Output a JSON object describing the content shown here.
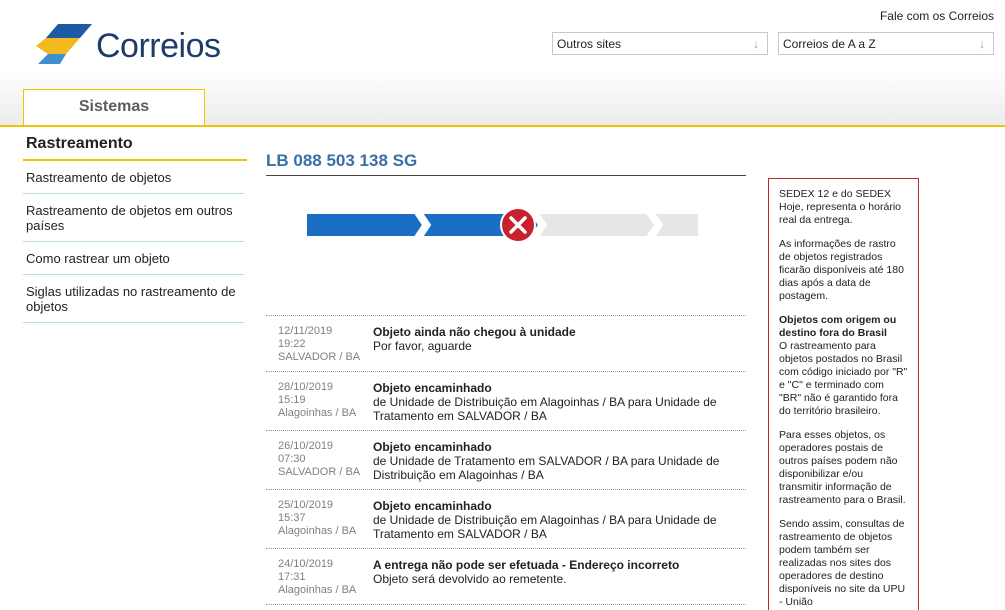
{
  "header": {
    "logo_text": "Correios",
    "contact_link": "Fale com os Correios",
    "select_other_sites": "Outros sites",
    "select_a_to_z": "Correios de A a Z",
    "tab_label": "Sistemas"
  },
  "sidebar": {
    "title": "Rastreamento",
    "items": [
      {
        "label": "Rastreamento de objetos"
      },
      {
        "label": "Rastreamento de objetos em outros países"
      },
      {
        "label": "Como rastrear um objeto"
      },
      {
        "label": "Siglas utilizadas no rastreamento de objetos"
      }
    ]
  },
  "tracking": {
    "code": "LB 088 503 138 SG",
    "progress": {
      "completed_steps": 2,
      "total_steps": 4,
      "status": "error",
      "status_icon": "x-circle-icon",
      "active_color": "#1a6fc4",
      "inactive_color": "#e6e6e6",
      "error_color": "#c8202e"
    },
    "events": [
      {
        "date": "12/11/2019",
        "time": "19:22",
        "place": "SALVADOR / BA",
        "title": "Objeto ainda não chegou à unidade",
        "detail": "Por favor, aguarde"
      },
      {
        "date": "28/10/2019",
        "time": "15:19",
        "place": "Alagoinhas / BA",
        "title": "Objeto encaminhado",
        "detail": "de Unidade de Distribuição em Alagoinhas / BA para Unidade de Tratamento em SALVADOR / BA"
      },
      {
        "date": "26/10/2019",
        "time": "07:30",
        "place": "SALVADOR / BA",
        "title": "Objeto encaminhado",
        "detail": "de Unidade de Tratamento em SALVADOR / BA para Unidade de Distribuição em Alagoinhas / BA"
      },
      {
        "date": "25/10/2019",
        "time": "15:37",
        "place": "Alagoinhas / BA",
        "title": "Objeto encaminhado",
        "detail": "de Unidade de Distribuição em Alagoinhas / BA para Unidade de Tratamento em SALVADOR / BA"
      },
      {
        "date": "24/10/2019",
        "time": "17:31",
        "place": "Alagoinhas / BA",
        "title": "A entrega não pode ser efetuada - Endereço incorreto",
        "detail": "Objeto será devolvido ao remetente."
      }
    ]
  },
  "info_box": {
    "p1": "SEDEX 12 e do SEDEX Hoje, representa o horário real da entrega.",
    "p2": "As informações de rastro de objetos registrados ficarão disponíveis até 180 dias após a data de postagem.",
    "p3_title": "Objetos com origem ou destino fora do Brasil",
    "p3": "O rastreamento para objetos postados no Brasil com código iniciado por \"R\" e \"C\" e terminado com \"BR\" não é garantido fora do território brasileiro.",
    "p4": "Para esses objetos, os operadores postais de outros países podem não disponibilizar e/ou transmitir informação de rastreamento para o Brasil.",
    "p5": "Sendo assim, consultas de rastreamento de objetos podem também ser realizadas nos sites dos operadores de destino disponíveis no site da UPU - União"
  }
}
